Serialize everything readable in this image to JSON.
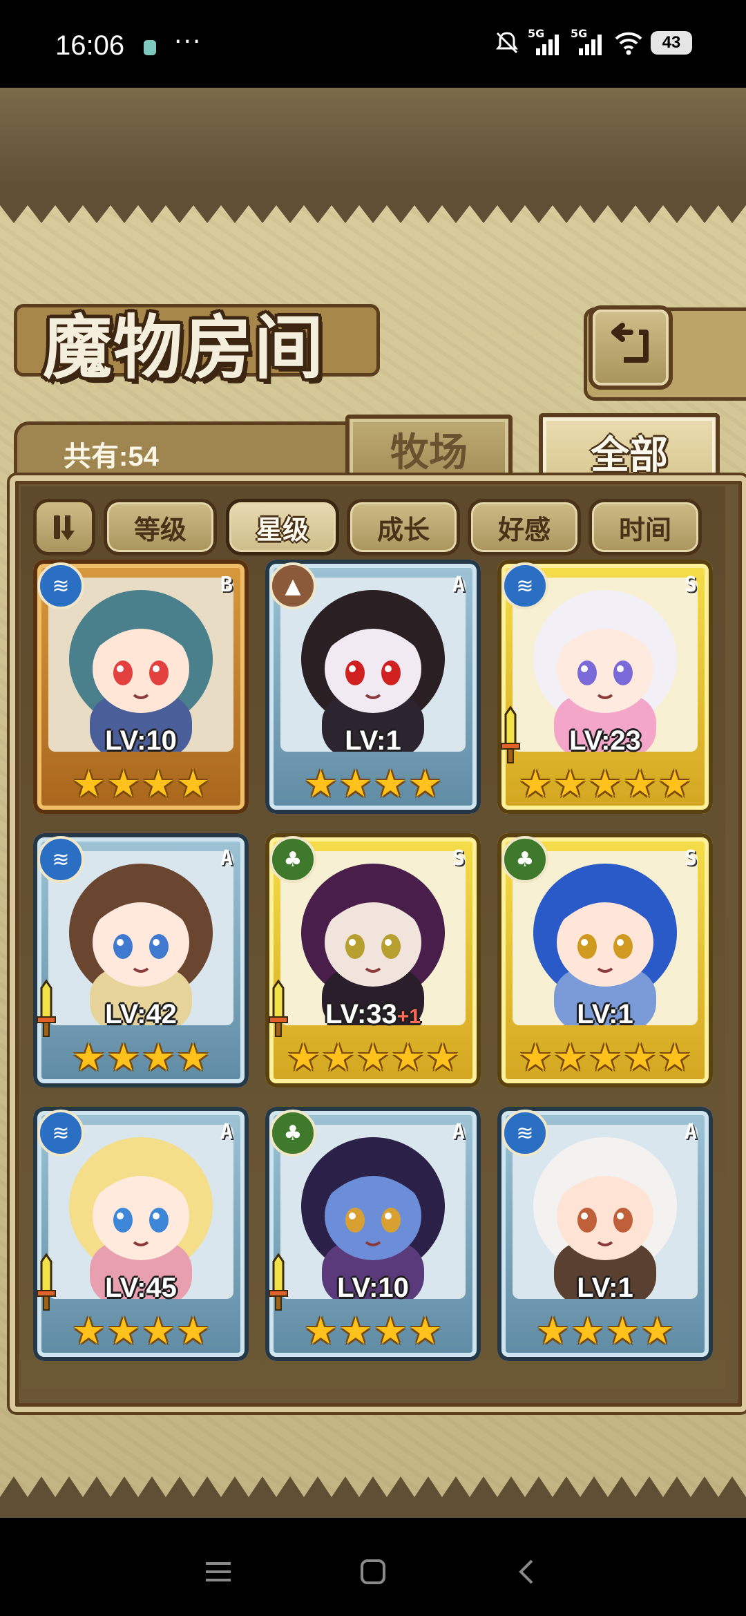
{
  "status_bar": {
    "time": "16:06",
    "dots": "···",
    "signal_1_label": "5G",
    "signal_2_label": "5G",
    "battery": "43",
    "icons": [
      "silent-bell-icon",
      "signal-icon",
      "wifi-icon",
      "battery-icon"
    ]
  },
  "header": {
    "title": "魔物房间",
    "back_icon": "return-arrow-icon"
  },
  "tabs": {
    "count_label": "共有:54",
    "ranch": "牧场",
    "all": "全部"
  },
  "sort": {
    "toggle_label": "⇃⇂",
    "options": [
      "等级",
      "星级",
      "成长",
      "好感",
      "时间"
    ],
    "active": "星级"
  },
  "monsters": [
    {
      "element": "water",
      "rank": "B",
      "level": "LV:10",
      "plus": "",
      "stars": 4,
      "frame": "bronze",
      "weapon": false,
      "hair": "#4a7f8c",
      "skin": "#ffe6d6",
      "outfit": "#4a5f99",
      "eyes": "#e34040"
    },
    {
      "element": "earth",
      "rank": "A",
      "level": "LV:1",
      "plus": "",
      "stars": 4,
      "frame": "blue",
      "weapon": false,
      "hair": "#2a1f22",
      "skin": "#f2eaf2",
      "outfit": "#2c2530",
      "eyes": "#d02020"
    },
    {
      "element": "water",
      "rank": "S",
      "level": "LV:23",
      "plus": "",
      "stars": 5,
      "frame": "gold",
      "weapon": true,
      "hair": "#f2f0f6",
      "skin": "#ffeadf",
      "outfit": "#f4a6c8",
      "eyes": "#7a6ad8"
    },
    {
      "element": "water",
      "rank": "A",
      "level": "LV:42",
      "plus": "",
      "stars": 4,
      "frame": "blue",
      "weapon": true,
      "hair": "#6a4530",
      "skin": "#ffe9dc",
      "outfit": "#e6d49a",
      "eyes": "#3f7ad0"
    },
    {
      "element": "wood",
      "rank": "S",
      "level": "LV:33",
      "plus": "+1",
      "stars": 5,
      "frame": "gold",
      "weapon": true,
      "hair": "#4a1e4a",
      "skin": "#f0e4dc",
      "outfit": "#2a1e2a",
      "eyes": "#b8a030"
    },
    {
      "element": "wood",
      "rank": "S",
      "level": "LV:1",
      "plus": "",
      "stars": 5,
      "frame": "gold",
      "weapon": false,
      "hair": "#2a5ac8",
      "skin": "#ffe6d8",
      "outfit": "#7a9ad8",
      "eyes": "#d09a20"
    },
    {
      "element": "water",
      "rank": "A",
      "level": "LV:45",
      "plus": "",
      "stars": 4,
      "frame": "blue",
      "weapon": true,
      "hair": "#f4de8a",
      "skin": "#ffeadd",
      "outfit": "#e8a0b0",
      "eyes": "#3e86d8"
    },
    {
      "element": "wood",
      "rank": "A",
      "level": "LV:10",
      "plus": "",
      "stars": 4,
      "frame": "blue",
      "weapon": true,
      "hair": "#2a2048",
      "skin": "#6c8ed8",
      "outfit": "#5a3a7a",
      "eyes": "#d8a030"
    },
    {
      "element": "water",
      "rank": "A",
      "level": "LV:1",
      "plus": "",
      "stars": 4,
      "frame": "blue",
      "weapon": false,
      "hair": "#f4f2f0",
      "skin": "#ffe4d6",
      "outfit": "#5a4030",
      "eyes": "#c0603a"
    }
  ],
  "nav": {
    "menu_icon": "menu-icon",
    "home_icon": "home-icon",
    "back_icon": "back-icon"
  },
  "colors": {
    "parchment": "#d3c596",
    "panel": "#6a5634",
    "outline": "#5a3e1e",
    "star": "#ffc21c",
    "water": "#2a6fc4",
    "earth": "#8a5a3a",
    "wood": "#3f7a2c"
  }
}
